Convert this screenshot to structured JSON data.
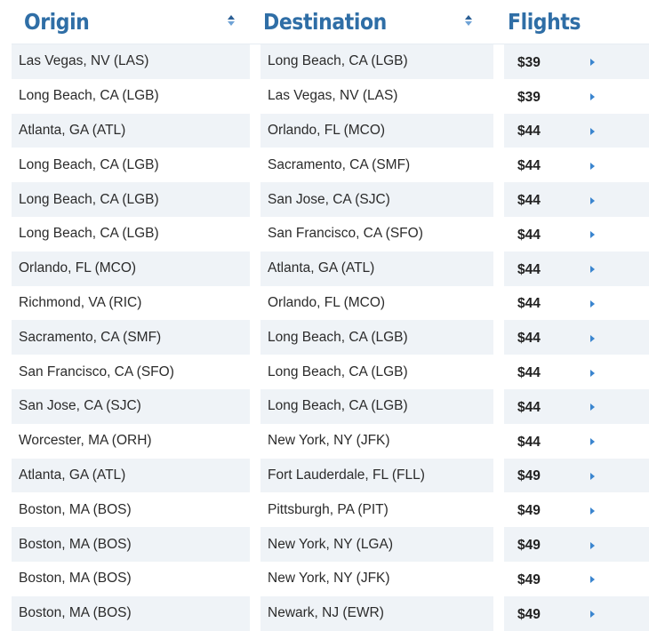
{
  "header": {
    "origin_label": "Origin",
    "destination_label": "Destination",
    "flights_label": "Flights",
    "sort_icon": "sort-up-down-icon"
  },
  "colors": {
    "header_text": "#2f6ea6",
    "row_alt_bg": "#eff3f7",
    "arrow": "#3a85cf"
  },
  "rows": [
    {
      "origin": "Las Vegas, NV (LAS)",
      "destination": "Long Beach, CA (LGB)",
      "price": "$39"
    },
    {
      "origin": "Long Beach, CA (LGB)",
      "destination": "Las Vegas, NV (LAS)",
      "price": "$39"
    },
    {
      "origin": "Atlanta, GA (ATL)",
      "destination": "Orlando, FL (MCO)",
      "price": "$44"
    },
    {
      "origin": "Long Beach, CA (LGB)",
      "destination": "Sacramento, CA (SMF)",
      "price": "$44"
    },
    {
      "origin": "Long Beach, CA (LGB)",
      "destination": "San Jose, CA (SJC)",
      "price": "$44"
    },
    {
      "origin": "Long Beach, CA (LGB)",
      "destination": "San Francisco, CA (SFO)",
      "price": "$44"
    },
    {
      "origin": "Orlando, FL (MCO)",
      "destination": "Atlanta, GA (ATL)",
      "price": "$44"
    },
    {
      "origin": "Richmond, VA (RIC)",
      "destination": "Orlando, FL (MCO)",
      "price": "$44"
    },
    {
      "origin": "Sacramento, CA (SMF)",
      "destination": "Long Beach, CA (LGB)",
      "price": "$44"
    },
    {
      "origin": "San Francisco, CA (SFO)",
      "destination": "Long Beach, CA (LGB)",
      "price": "$44"
    },
    {
      "origin": "San Jose, CA (SJC)",
      "destination": "Long Beach, CA (LGB)",
      "price": "$44"
    },
    {
      "origin": "Worcester, MA (ORH)",
      "destination": "New York, NY (JFK)",
      "price": "$44"
    },
    {
      "origin": "Atlanta, GA (ATL)",
      "destination": "Fort Lauderdale, FL (FLL)",
      "price": "$49"
    },
    {
      "origin": "Boston, MA (BOS)",
      "destination": "Pittsburgh, PA (PIT)",
      "price": "$49"
    },
    {
      "origin": "Boston, MA (BOS)",
      "destination": "New York, NY (LGA)",
      "price": "$49"
    },
    {
      "origin": "Boston, MA (BOS)",
      "destination": "New York, NY (JFK)",
      "price": "$49"
    },
    {
      "origin": "Boston, MA (BOS)",
      "destination": "Newark, NJ (EWR)",
      "price": "$49"
    }
  ]
}
